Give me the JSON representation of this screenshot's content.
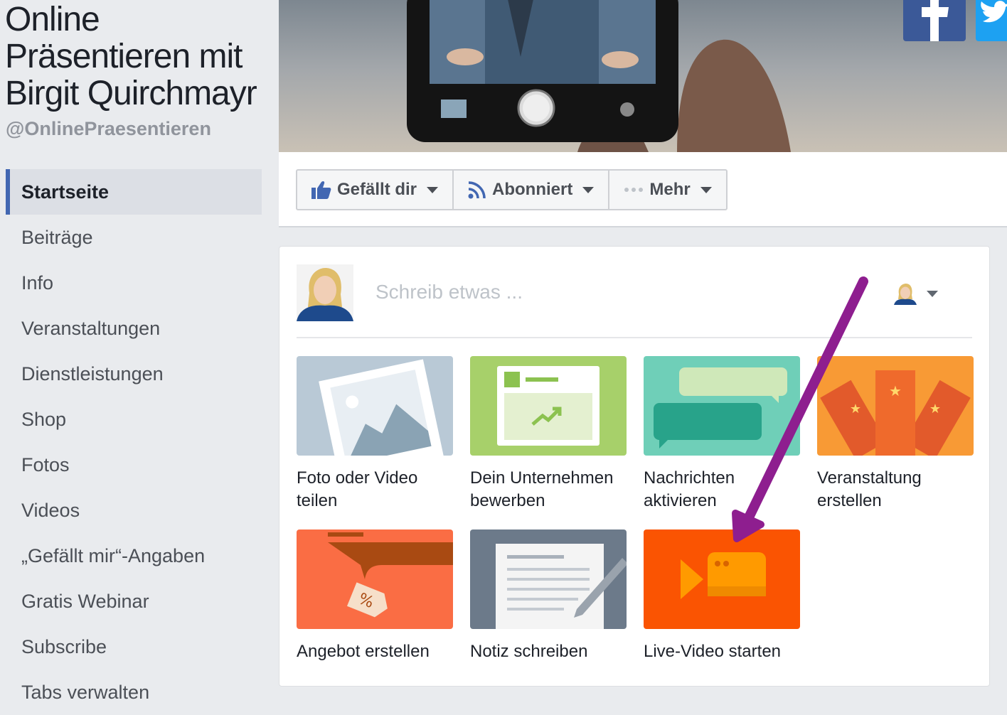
{
  "page": {
    "title": "Online Präsentieren mit Birgit Quirchmayr",
    "handle": "@OnlinePraesentieren"
  },
  "nav": {
    "items": [
      {
        "label": "Startseite",
        "active": true
      },
      {
        "label": "Beiträge"
      },
      {
        "label": "Info"
      },
      {
        "label": "Veranstaltungen"
      },
      {
        "label": "Dienstleistungen"
      },
      {
        "label": "Shop"
      },
      {
        "label": "Fotos"
      },
      {
        "label": "Videos"
      },
      {
        "label": "„Gefällt mir“-Angaben"
      },
      {
        "label": "Gratis Webinar"
      },
      {
        "label": "Subscribe"
      },
      {
        "label": "Tabs verwalten"
      }
    ]
  },
  "actions": {
    "like_label": "Gefällt dir",
    "follow_label": "Abonniert",
    "more_label": "Mehr"
  },
  "composer": {
    "placeholder": "Schreib etwas ...",
    "tiles": [
      {
        "label": "Foto oder Video teilen",
        "icon": "photo-icon"
      },
      {
        "label": "Dein Unternehmen bewerben",
        "icon": "promote-icon"
      },
      {
        "label": "Nachrichten aktivieren",
        "icon": "messages-icon"
      },
      {
        "label": "Veranstaltung erstellen",
        "icon": "event-icon"
      },
      {
        "label": "Angebot erstellen",
        "icon": "offer-icon"
      },
      {
        "label": "Notiz schreiben",
        "icon": "note-icon"
      },
      {
        "label": "Live-Video starten",
        "icon": "live-video-icon",
        "highlighted": true
      }
    ]
  },
  "colors": {
    "facebook_blue": "#4267b2",
    "highlight": "#ffff3c",
    "annotation_arrow": "#8e1e8f"
  }
}
